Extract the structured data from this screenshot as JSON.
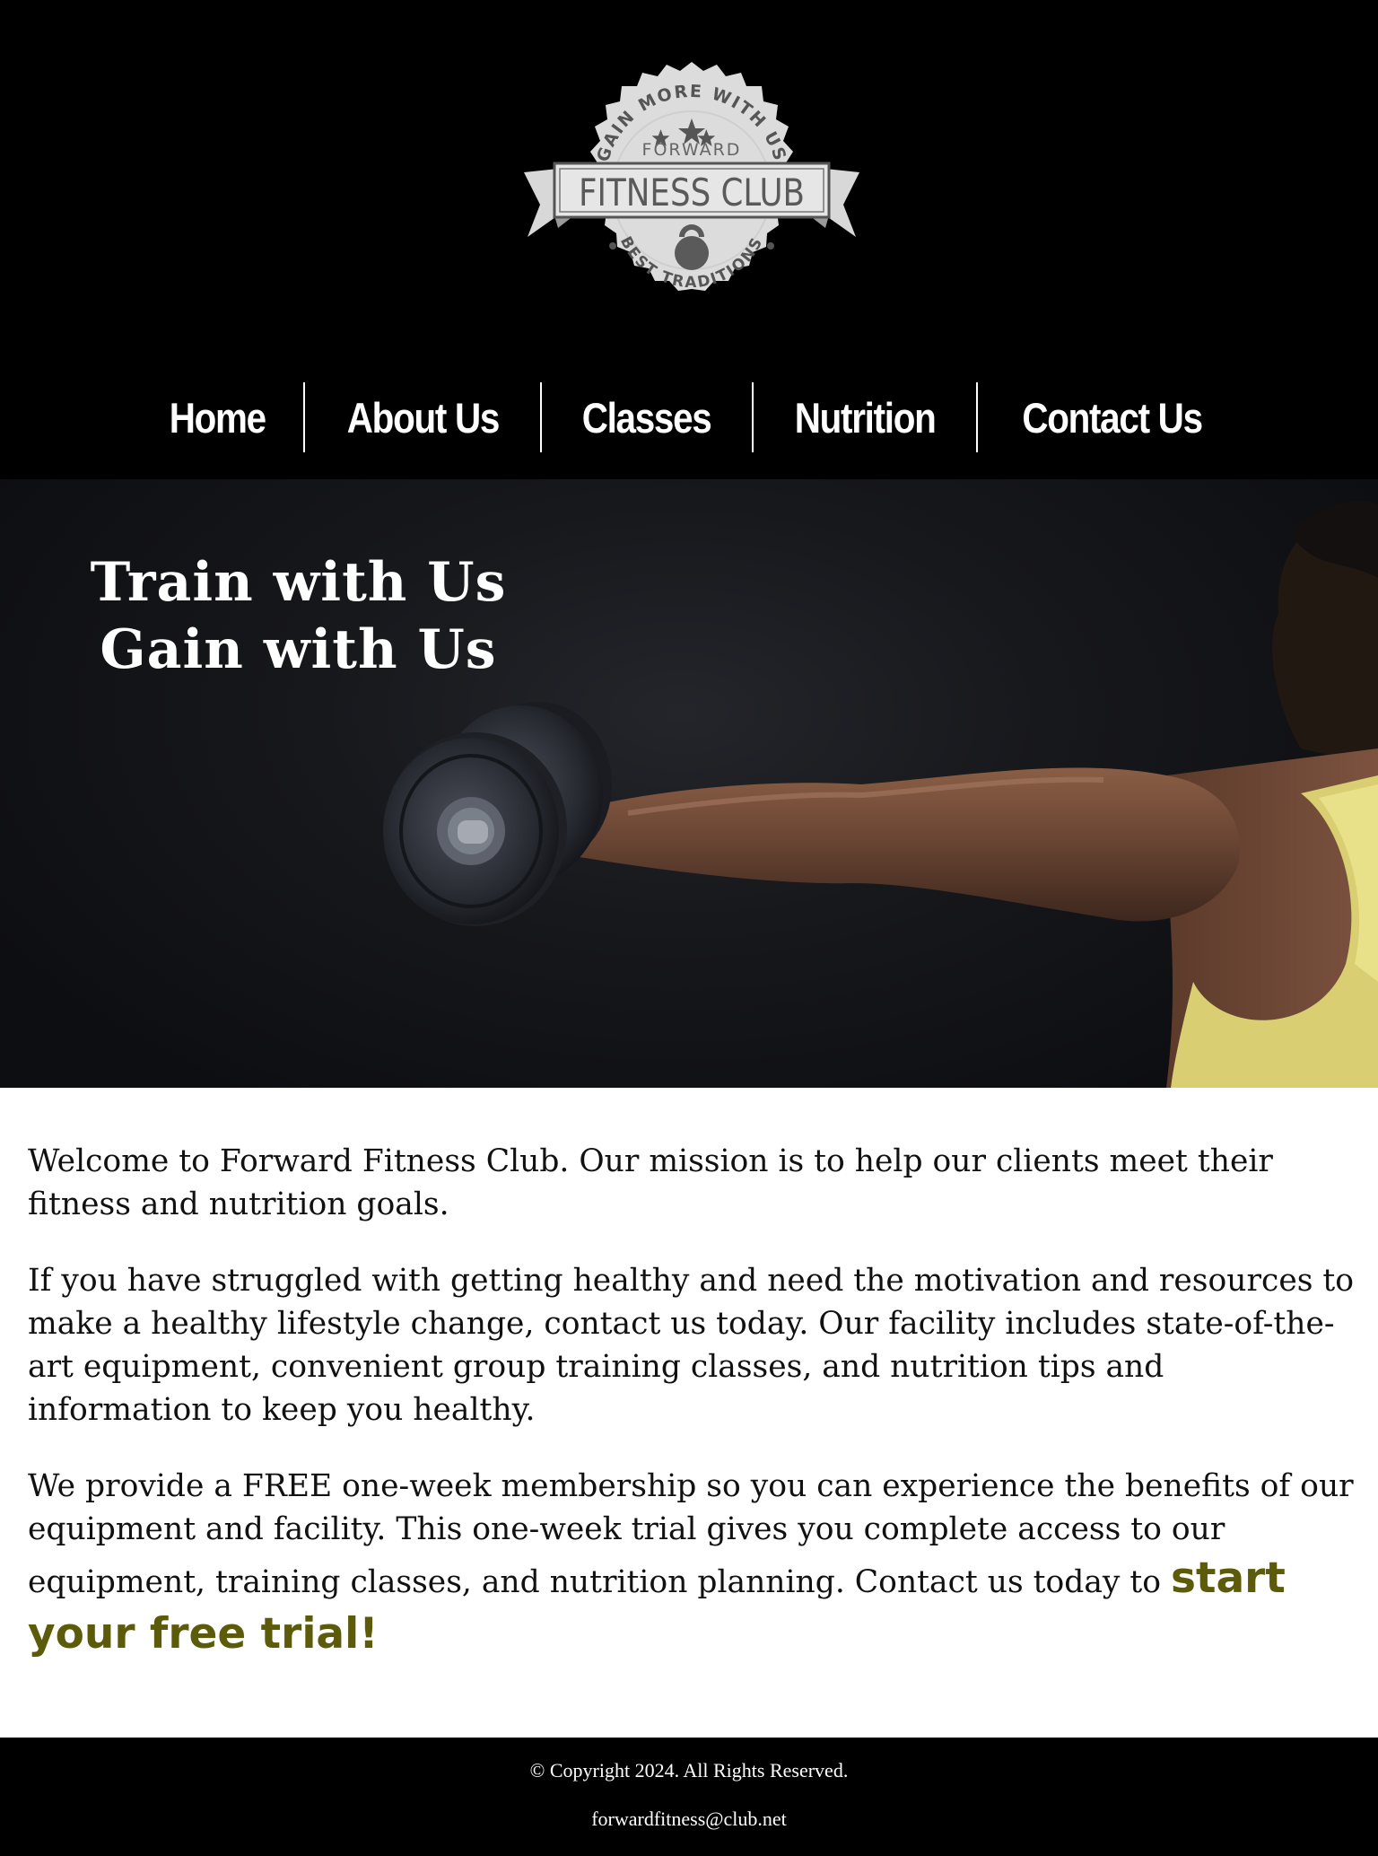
{
  "header": {
    "logo": {
      "arc_top": "GAIN MORE WITH US",
      "subtitle": "FORWARD",
      "banner": "FITNESS CLUB",
      "arc_bottom": "BEST TRADITIONS"
    }
  },
  "nav": {
    "items": [
      {
        "label": "Home"
      },
      {
        "label": "About Us"
      },
      {
        "label": "Classes"
      },
      {
        "label": "Nutrition"
      },
      {
        "label": "Contact Us"
      }
    ]
  },
  "hero": {
    "line1": "Train with Us",
    "line2": "Gain with Us"
  },
  "main": {
    "para1": "Welcome to Forward Fitness Club. Our mission is to help our clients meet their fitness and nutrition goals.",
    "para2": "If you have struggled with getting healthy and need the motivation and resources to make a healthy lifestyle change, contact us today. Our facility includes state-of-the-art equipment, convenient group training classes, and nutrition tips and information to keep you healthy.",
    "para3": "We provide a FREE one-week membership so you can experience the benefits of our equipment and facility. This one-week trial gives you complete access to our equipment, training classes, and nutrition planning. Contact us today to ",
    "cta": "start your free trial!"
  },
  "footer": {
    "copyright": "© Copyright 2024. All Rights Reserved.",
    "email": "forwardfitness@club.net"
  },
  "colors": {
    "header_bg": "#000000",
    "cta": "#5b5b0a",
    "footer_bg": "#000000"
  }
}
